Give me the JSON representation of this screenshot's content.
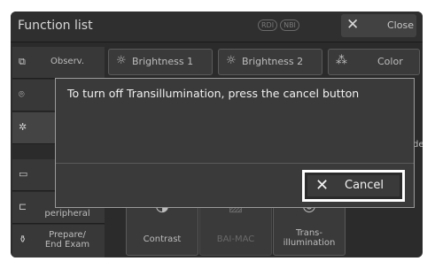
{
  "header": {
    "title": "Function list",
    "badges": [
      "RDI",
      "NBI"
    ],
    "close_label": "Close"
  },
  "sidebar": {
    "items": [
      {
        "label": "Observ.",
        "icon": "observation-icon"
      },
      {
        "label": "",
        "icon": "camera-icon"
      },
      {
        "label": "",
        "icon": "brightness-small-icon"
      },
      {
        "label": "",
        "icon": "monitor-icon"
      },
      {
        "label": "peripheral",
        "icon": "peripheral-icon"
      },
      {
        "label": "Prepare/\nEnd Exam",
        "icon": "prepare-icon"
      }
    ]
  },
  "tabs": [
    {
      "label": "Brightness 1",
      "icon": "sun-icon"
    },
    {
      "label": "Brightness 2",
      "icon": "sun-icon"
    },
    {
      "label": "Color",
      "icon": "color-icon"
    }
  ],
  "tiles": [
    {
      "label": "Contrast",
      "icon": "contrast-icon"
    },
    {
      "label": "BAI-MAC",
      "icon": "bai-mac-icon"
    },
    {
      "label": "Trans-\nillumination",
      "icon": "transillumination-icon"
    }
  ],
  "partial_text": "de",
  "dialog": {
    "message": "To turn off Transillumination, press the cancel button",
    "cancel_label": "Cancel"
  },
  "colors": {
    "panel": "#2b2b2b",
    "accent_border": "#ffffff"
  }
}
